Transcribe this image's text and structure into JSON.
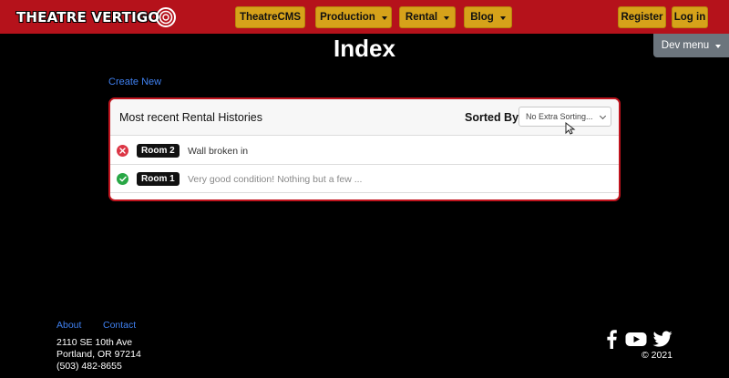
{
  "brand": {
    "name": "THEATRE VERTIGO"
  },
  "nav": {
    "items": [
      {
        "label": "TheatreCMS",
        "dropdown": false
      },
      {
        "label": "Production",
        "dropdown": true
      },
      {
        "label": "Rental",
        "dropdown": true
      },
      {
        "label": "Blog",
        "dropdown": true
      }
    ],
    "register_label": "Register",
    "login_label": "Log in",
    "dev_menu_label": "Dev menu"
  },
  "page": {
    "title": "Index",
    "create_link": "Create New"
  },
  "card": {
    "title": "Most recent Rental Histories",
    "sort_label": "Sorted By:",
    "sort_value": "No Extra Sorting...",
    "rows": [
      {
        "status": "damaged",
        "status_icon": "x-circle-icon",
        "room": "Room 2",
        "note": "Wall broken in"
      },
      {
        "status": "good",
        "status_icon": "check-circle-icon",
        "room": "Room 1",
        "note": "Very good condition! Nothing but a few ..."
      }
    ]
  },
  "footer": {
    "about_label": "About",
    "contact_label": "Contact",
    "address_line1": "2110 SE 10th Ave",
    "address_line2": "Portland, OR 97214",
    "phone": "(503) 482-8655",
    "social_icons": [
      "facebook-icon",
      "youtube-icon",
      "twitter-icon"
    ],
    "copyright": "© 2021"
  },
  "colors": {
    "navbar": "#b5121b",
    "nav_button": "#d6a21a",
    "dev_menu": "#6c757d",
    "link": "#3f80f0",
    "card_border": "#c0141e",
    "status_bad": "#dc3545",
    "status_good": "#28a745"
  }
}
